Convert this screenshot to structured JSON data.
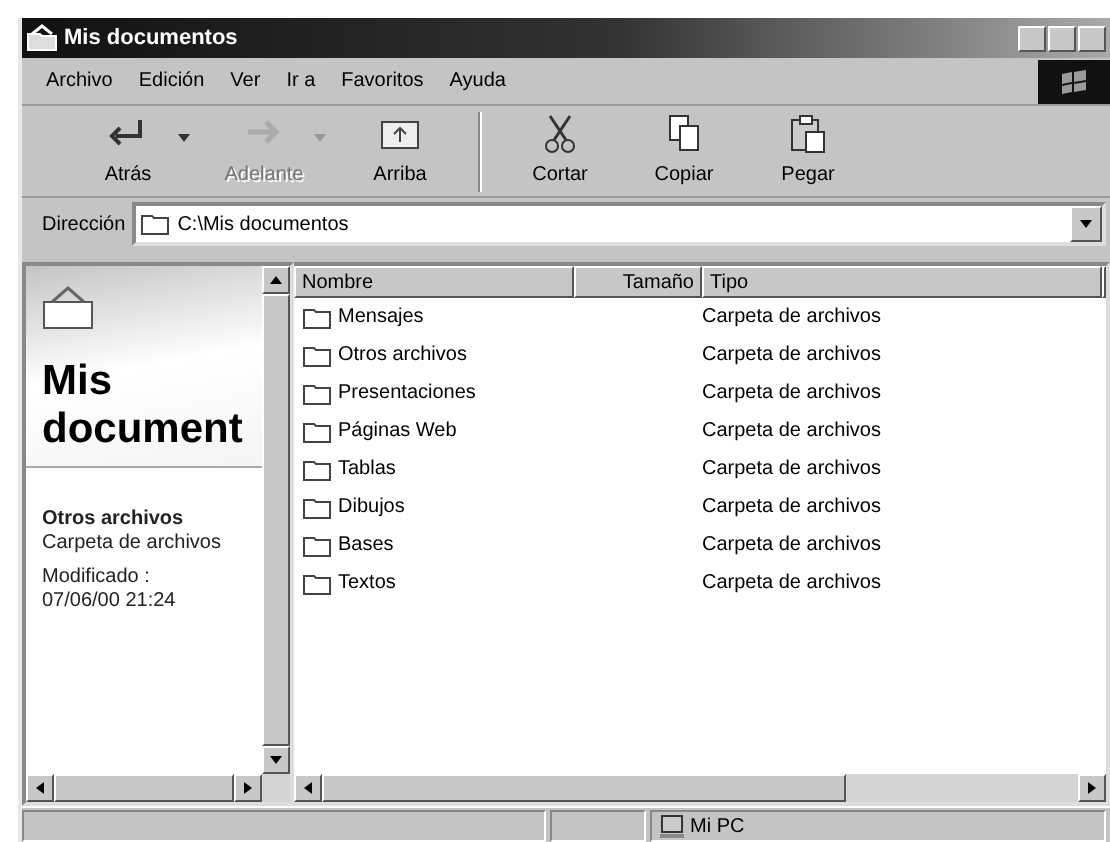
{
  "window": {
    "title": "Mis documentos"
  },
  "menu": [
    "Archivo",
    "Edición",
    "Ver",
    "Ir a",
    "Favoritos",
    "Ayuda"
  ],
  "toolbar": [
    {
      "kind": "back",
      "label": "Atrás",
      "dropdown": true,
      "disabled": false
    },
    {
      "kind": "forward",
      "label": "Adelante",
      "dropdown": true,
      "disabled": true
    },
    {
      "kind": "up",
      "label": "Arriba",
      "dropdown": false,
      "disabled": false
    },
    {
      "kind": "separator"
    },
    {
      "kind": "cut",
      "label": "Cortar",
      "dropdown": false,
      "disabled": false
    },
    {
      "kind": "copy",
      "label": "Copiar",
      "dropdown": false,
      "disabled": false
    },
    {
      "kind": "paste",
      "label": "Pegar",
      "dropdown": false,
      "disabled": false
    }
  ],
  "address": {
    "label": "Dirección",
    "value": "C:\\Mis documentos"
  },
  "side_panel": {
    "title": "Mis document",
    "item_name": "Otros archivos",
    "item_type": "Carpeta de archivos",
    "modified_label": "Modificado :",
    "modified": "07/06/00 21:24"
  },
  "table": {
    "columns": [
      "Nombre",
      "Tamaño",
      "Tipo"
    ],
    "rows": [
      {
        "name": "Mensajes",
        "type": "Carpeta de archivos"
      },
      {
        "name": "Otros archivos",
        "type": "Carpeta de archivos"
      },
      {
        "name": "Presentaciones",
        "type": "Carpeta de archivos"
      },
      {
        "name": "Páginas Web",
        "type": "Carpeta de archivos"
      },
      {
        "name": "Tablas",
        "type": "Carpeta de archivos"
      },
      {
        "name": "Dibujos",
        "type": "Carpeta de archivos"
      },
      {
        "name": "Bases",
        "type": "Carpeta de archivos"
      },
      {
        "name": "Textos",
        "type": "Carpeta de archivos"
      }
    ]
  },
  "status_bar": {
    "location": "Mi PC"
  }
}
